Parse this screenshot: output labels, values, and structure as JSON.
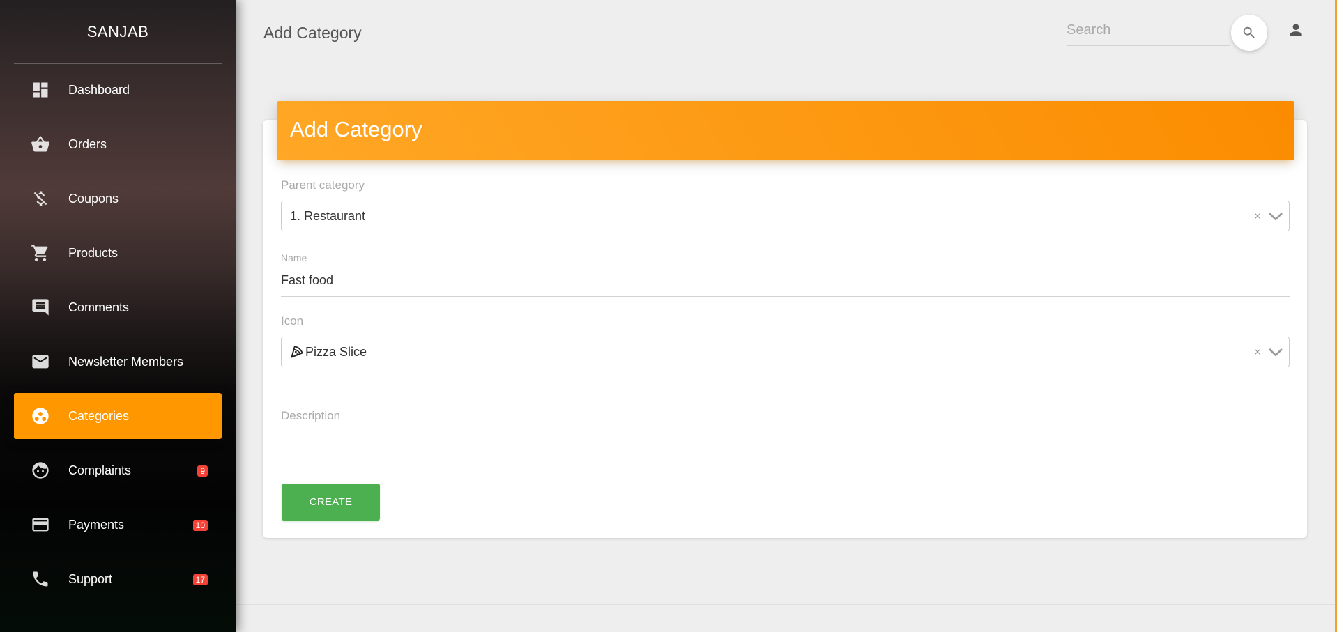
{
  "sidebar": {
    "brand": "SANJAB",
    "items": [
      {
        "label": "Dashboard",
        "icon": "dashboard-icon"
      },
      {
        "label": "Orders",
        "icon": "basket-icon"
      },
      {
        "label": "Coupons",
        "icon": "money-off-icon"
      },
      {
        "label": "Products",
        "icon": "shopping-cart-icon"
      },
      {
        "label": "Comments",
        "icon": "comment-icon"
      },
      {
        "label": "Newsletter Members",
        "icon": "mail-icon"
      },
      {
        "label": "Categories",
        "icon": "categories-icon",
        "active": true
      },
      {
        "label": "Complaints",
        "icon": "face-icon",
        "badge": "9"
      },
      {
        "label": "Payments",
        "icon": "credit-card-icon",
        "badge": "10"
      },
      {
        "label": "Support",
        "icon": "phone-icon",
        "badge": "17"
      }
    ]
  },
  "header": {
    "title": "Add Category",
    "search_placeholder": "Search"
  },
  "card": {
    "title": "Add Category",
    "parent_label": "Parent category",
    "parent_value": "1. Restaurant",
    "name_label": "Name",
    "name_value": "Fast food",
    "icon_label": "Icon",
    "icon_value": "Pizza Slice",
    "description_label": "Description",
    "description_value": "",
    "create_label": "CREATE"
  },
  "colors": {
    "accent": "#ff9800",
    "create_button": "#4caf50",
    "badge": "#f44336"
  }
}
